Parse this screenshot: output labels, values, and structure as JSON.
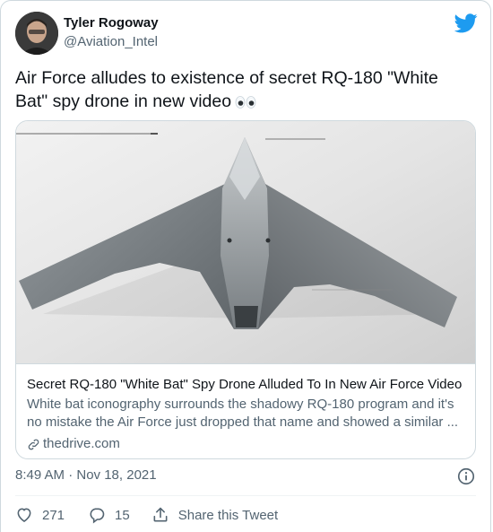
{
  "author": {
    "name": "Tyler Rogoway",
    "handle": "@Aviation_Intel"
  },
  "tweet": {
    "text": "Air Force alludes to existence of secret RQ-180 \"White Bat\" spy drone in new video",
    "emoji": "eyes-emoji"
  },
  "link_card": {
    "image": "flying-wing-drone-image",
    "title": "Secret RQ-180 \"White Bat\" Spy Drone Alluded To In New Air Force Video",
    "description": "White bat iconography surrounds the shadowy RQ-180 program and it's no mistake the Air Force just dropped that name and showed a similar ...",
    "domain": "thedrive.com"
  },
  "timestamp": "8:49 AM · Nov 18, 2021",
  "actions": {
    "likes": "271",
    "replies": "15",
    "share_label": "Share this Tweet"
  },
  "colors": {
    "twitter_blue": "#1d9bf0",
    "text_primary": "#0f1419",
    "text_secondary": "#536471",
    "border": "#cfd9de"
  },
  "icons": [
    "twitter-bird-icon",
    "link-icon",
    "info-icon",
    "heart-icon",
    "reply-icon",
    "share-icon"
  ]
}
